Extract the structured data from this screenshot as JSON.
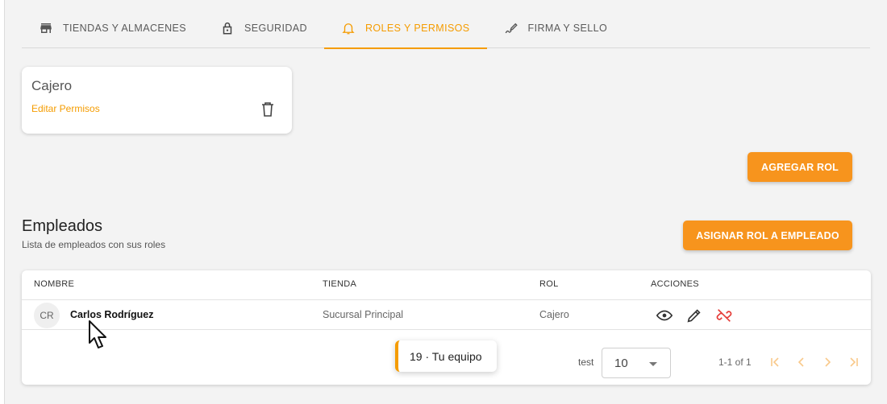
{
  "tabs": [
    {
      "label": "TIENDAS Y ALMACENES",
      "icon": "store-icon"
    },
    {
      "label": "SEGURIDAD",
      "icon": "lock-icon"
    },
    {
      "label": "ROLES Y PERMISOS",
      "icon": "bell-icon",
      "active": true
    },
    {
      "label": "FIRMA Y SELLO",
      "icon": "signature-icon"
    }
  ],
  "role_card": {
    "name": "Cajero",
    "edit_label": "Editar Permisos",
    "delete_icon": "trash-icon"
  },
  "buttons": {
    "add_role": "AGREGAR ROL",
    "assign_role": "ASIGNAR ROL A EMPLEADO"
  },
  "employees": {
    "title": "Empleados",
    "subtitle": "Lista de empleados con sus roles",
    "columns": [
      "NOMBRE",
      "TIENDA",
      "ROL",
      "ACCIONES"
    ],
    "rows": [
      {
        "initials": "CR",
        "name": "Carlos Rodríguez",
        "store": "Sucursal Principal",
        "role": "Cajero",
        "actions": [
          "eye-icon",
          "pencil-icon",
          "unlink-icon"
        ]
      }
    ]
  },
  "pagination": {
    "label": "test",
    "rows_per_page": "10",
    "range": "1-1 of 1"
  },
  "toast": {
    "text": "19 · Tu equipo"
  },
  "colors": {
    "accent": "#f59c00",
    "button": "#f7941d",
    "danger": "#e53935"
  }
}
